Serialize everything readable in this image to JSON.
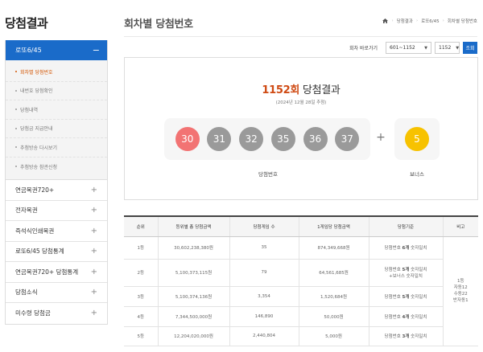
{
  "sidebar": {
    "title": "당첨결과",
    "active_menu": "로또6/45",
    "active_sign": "−",
    "sub_items": [
      "회차별 당첨번호",
      "내번호 당첨확인",
      "당첨내역",
      "당첨금 지급안내",
      "추첨방송 다시보기",
      "추첨방송 참관신청"
    ],
    "menu_items": [
      "연금복권720+",
      "전자복권",
      "즉석식인쇄복권",
      "로또6/45 당첨통계",
      "연금복권720+ 당첨통계",
      "당첨소식",
      "미수령 당첨금"
    ],
    "menu_sign": "+"
  },
  "header": {
    "title": "회차별 당첨번호",
    "breadcrumb": [
      "당첨결과",
      "로또6/45",
      "회차별 당첨번호"
    ]
  },
  "round_bar": {
    "label": "회차 바로가기",
    "range": "601~1152",
    "round": "1152",
    "button": "조회"
  },
  "result": {
    "round_no": "1152회",
    "title_suffix": " 당첨결과",
    "date": "(2024년 12월 28일 추첨)",
    "numbers": [
      "30",
      "31",
      "32",
      "35",
      "36",
      "37"
    ],
    "bonus": "5",
    "plus": "+",
    "main_caption": "당첨번호",
    "bonus_caption": "보너스"
  },
  "table": {
    "headers": [
      "순위",
      "등위별 총 당첨금액",
      "당첨게임 수",
      "1게임당 당첨금액",
      "당첨기준",
      "비고"
    ],
    "rows": [
      {
        "rank": "1등",
        "total": "30,602,238,380원",
        "games": "35",
        "per_game": "874,349,668원",
        "cond_pre": "당첨번호 ",
        "cond_strong": "6개",
        "cond_post": " 숫자일치",
        "cond_extra": ""
      },
      {
        "rank": "2등",
        "total": "5,100,373,115원",
        "games": "79",
        "per_game": "64,561,685원",
        "cond_pre": "당첨번호 ",
        "cond_strong": "5개",
        "cond_post": " 숫자일치",
        "cond_extra": "+보너스 숫자일치"
      },
      {
        "rank": "3등",
        "total": "5,100,374,136원",
        "games": "3,354",
        "per_game": "1,520,684원",
        "cond_pre": "당첨번호 ",
        "cond_strong": "5개",
        "cond_post": " 숫자일치",
        "cond_extra": ""
      },
      {
        "rank": "4등",
        "total": "7,344,500,000원",
        "games": "146,890",
        "per_game": "50,000원",
        "cond_pre": "당첨번호 ",
        "cond_strong": "4개",
        "cond_post": " 숫자일치",
        "cond_extra": ""
      },
      {
        "rank": "5등",
        "total": "12,204,020,000원",
        "games": "2,440,804",
        "per_game": "5,000원",
        "cond_pre": "당첨번호 ",
        "cond_strong": "3개",
        "cond_post": " 숫자일치",
        "cond_extra": ""
      }
    ],
    "note_lines": [
      "1등",
      "자동12",
      "수동22",
      "반자동1"
    ]
  },
  "colors": {
    "primary": "#1a6bc9",
    "accent": "#cf4a13",
    "ball_red": "#f27373",
    "ball_gray": "#9a9a9a",
    "ball_yellow": "#f7c200"
  },
  "icons": {
    "home": "home-icon",
    "select_arrow": "chevron-down-icon"
  }
}
